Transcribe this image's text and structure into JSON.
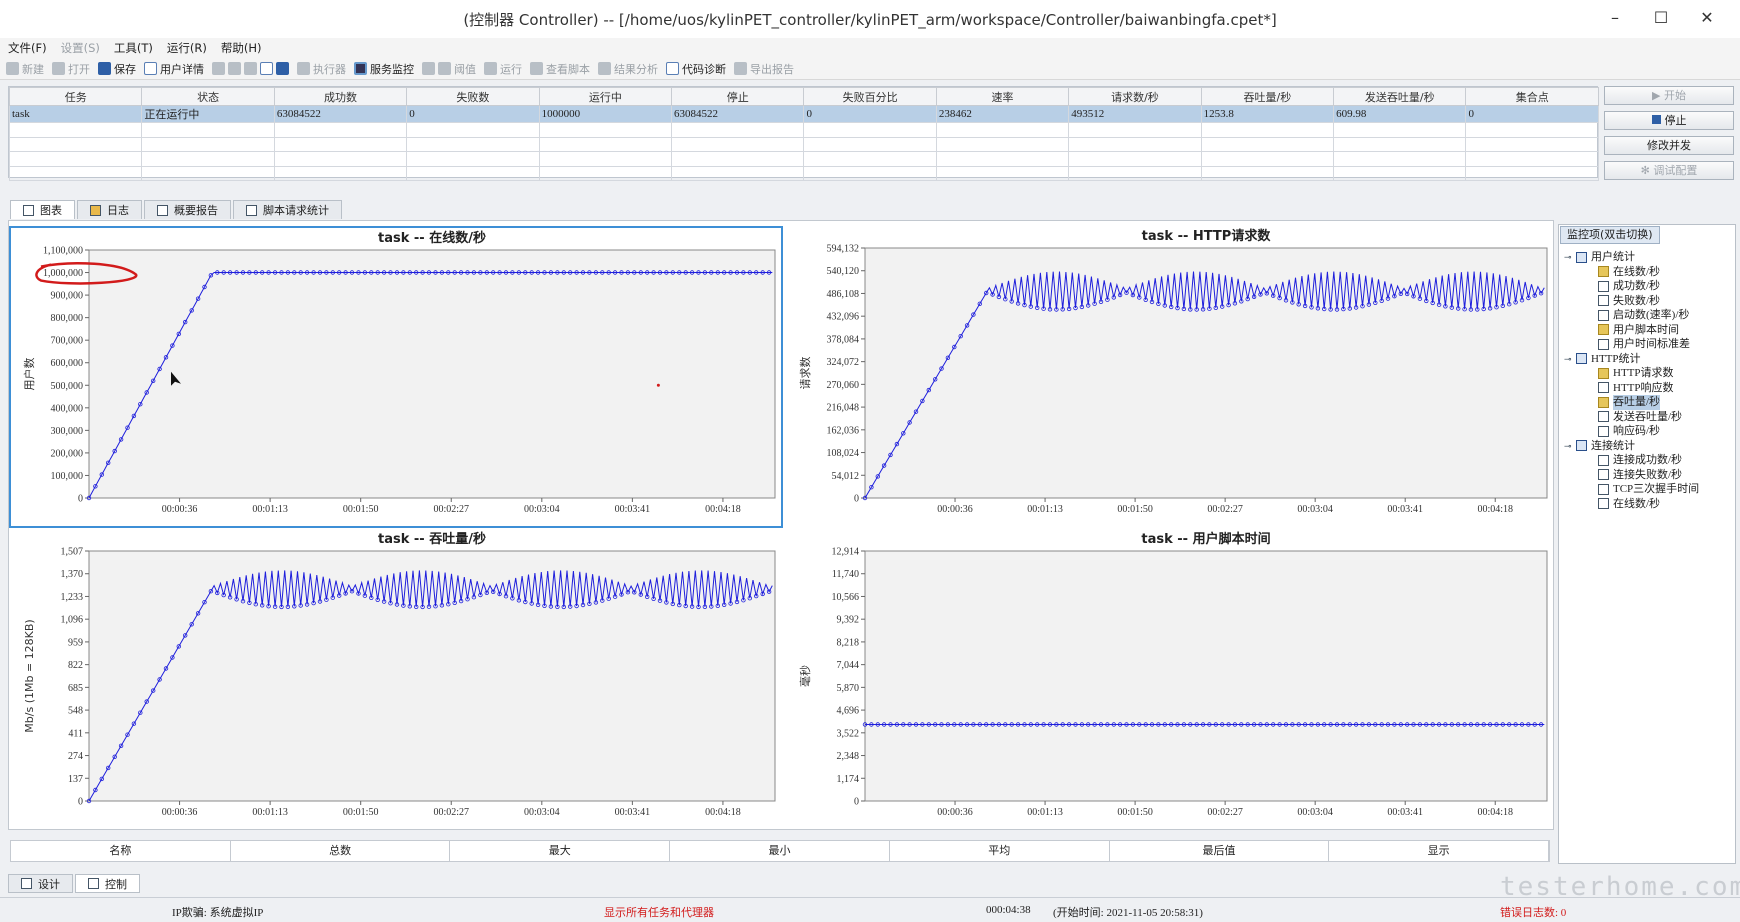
{
  "window": {
    "title": "(控制器 Controller) -- [/home/uos/kylinPET_controller/kylinPET_arm/workspace/Controller/baiwanbingfa.cpet*]",
    "minimize": "–",
    "maximize": "☐",
    "close": "✕"
  },
  "menu": [
    "文件(F)",
    "设置(S)",
    "工具(T)",
    "运行(R)",
    "帮助(H)"
  ],
  "toolbar": {
    "new": "新建",
    "open": "打开",
    "save": "保存",
    "user_detail": "用户详情",
    "executor": "执行器",
    "service_monitor": "服务监控",
    "threshold": "阈值",
    "run": "运行",
    "view_script": "查看脚本",
    "result_analysis": "结果分析",
    "code_diag": "代码诊断",
    "export_report": "导出报告"
  },
  "task_table": {
    "headers": [
      "任务",
      "状态",
      "成功数",
      "失败数",
      "运行中",
      "停止",
      "失败百分比",
      "速率",
      "请求数/秒",
      "吞吐量/秒",
      "发送吞吐量/秒",
      "集合点"
    ],
    "rows": [
      [
        "task",
        "正在运行中",
        "63084522",
        "0",
        "1000000",
        "63084522",
        "0",
        "238462",
        "493512",
        "1253.8",
        "609.98",
        "0"
      ]
    ]
  },
  "side_buttons": {
    "start": "开始",
    "stop": "停止",
    "modify": "修改并发",
    "debug": "调试配置"
  },
  "tabs": [
    "图表",
    "日志",
    "概要报告",
    "脚本请求统计"
  ],
  "monitor": {
    "title": "监控项(双击切换)",
    "groups": [
      {
        "name": "用户统计",
        "items": [
          "在线数/秒",
          "成功数/秒",
          "失败数/秒",
          "启动数(速率)/秒",
          "用户脚本时间",
          "用户时间标准差"
        ]
      },
      {
        "name": "HTTP统计",
        "items": [
          "HTTP请求数",
          "HTTP响应数",
          "吞吐量/秒",
          "发送吞吐量/秒",
          "响应码/秒"
        ]
      },
      {
        "name": "连接统计",
        "items": [
          "连接成功数/秒",
          "连接失败数/秒",
          "TCP三次握手时间",
          "在线数/秒"
        ]
      }
    ],
    "selected": "吞吐量/秒"
  },
  "stats_headers": [
    "名称",
    "总数",
    "最大",
    "最小",
    "平均",
    "最后值",
    "显示"
  ],
  "bottom_tabs": [
    "设计",
    "控制"
  ],
  "status": {
    "ip": "IP欺骗: 系统虚拟IP",
    "show_all": "显示所有任务和代理器",
    "elapsed": "000:04:38",
    "start_time": "(开始时间: 2021-11-05 20:58:31)",
    "errors": "错误日志数: 0"
  },
  "colors": {
    "series": "#1f1fdc",
    "focus_border": "#3d8fd6",
    "annotation": "#d21b1b"
  },
  "watermark": "testerhome.com",
  "chart_data": [
    {
      "type": "line",
      "title": "task -- 在线数/秒",
      "ylabel": "用户数",
      "ylim": [
        0,
        1100000
      ],
      "yticks": [
        "0",
        "100,000",
        "200,000",
        "300,000",
        "400,000",
        "500,000",
        "600,000",
        "700,000",
        "800,000",
        "900,000",
        "1,000,000",
        "1,100,000"
      ],
      "xticks": [
        "00:00:36",
        "00:01:13",
        "00:01:50",
        "00:02:27",
        "00:03:04",
        "00:03:41",
        "00:04:18"
      ],
      "x": [
        0,
        50,
        278
      ],
      "y": [
        0,
        1000000,
        1000000
      ],
      "pattern": "flat"
    },
    {
      "type": "line",
      "title": "task -- HTTP请求数",
      "ylabel": "请求数",
      "ylim": [
        0,
        594132
      ],
      "yticks": [
        "0",
        "54,012",
        "108,024",
        "162,036",
        "216,048",
        "270,060",
        "324,072",
        "378,084",
        "432,096",
        "486,108",
        "540,120",
        "594,132"
      ],
      "xticks": [
        "00:00:36",
        "00:01:13",
        "00:01:50",
        "00:02:27",
        "00:03:04",
        "00:03:41",
        "00:04:18"
      ],
      "x": [
        0,
        50,
        278
      ],
      "y": [
        0,
        493000,
        493000
      ],
      "pattern": "oscillate",
      "amplitude_range": [
        5000,
        45000
      ]
    },
    {
      "type": "line",
      "title": "task -- 吞吐量/秒",
      "ylabel": "Mb/s (1Mb = 128KB)",
      "ylim": [
        0,
        1507
      ],
      "yticks": [
        "0",
        "137",
        "274",
        "411",
        "548",
        "685",
        "822",
        "959",
        "1,096",
        "1,233",
        "1,370",
        "1,507"
      ],
      "xticks": [
        "00:00:36",
        "00:01:13",
        "00:01:50",
        "00:02:27",
        "00:03:04",
        "00:03:41",
        "00:04:18"
      ],
      "x": [
        0,
        50,
        278
      ],
      "y": [
        0,
        1280,
        1280
      ],
      "pattern": "oscillate",
      "amplitude_range": [
        15,
        110
      ]
    },
    {
      "type": "line",
      "title": "task -- 用户脚本时间",
      "ylabel": "毫秒",
      "ylim": [
        0,
        12914
      ],
      "yticks": [
        "0",
        "1,174",
        "2,348",
        "3,522",
        "4,696",
        "5,870",
        "7,044",
        "8,218",
        "9,392",
        "10,566",
        "11,740",
        "12,914"
      ],
      "xticks": [
        "00:00:36",
        "00:01:13",
        "00:01:50",
        "00:02:27",
        "00:03:04",
        "00:03:41",
        "00:04:18"
      ],
      "x": [
        0,
        278
      ],
      "y": [
        3950,
        3950
      ],
      "pattern": "flat"
    }
  ]
}
